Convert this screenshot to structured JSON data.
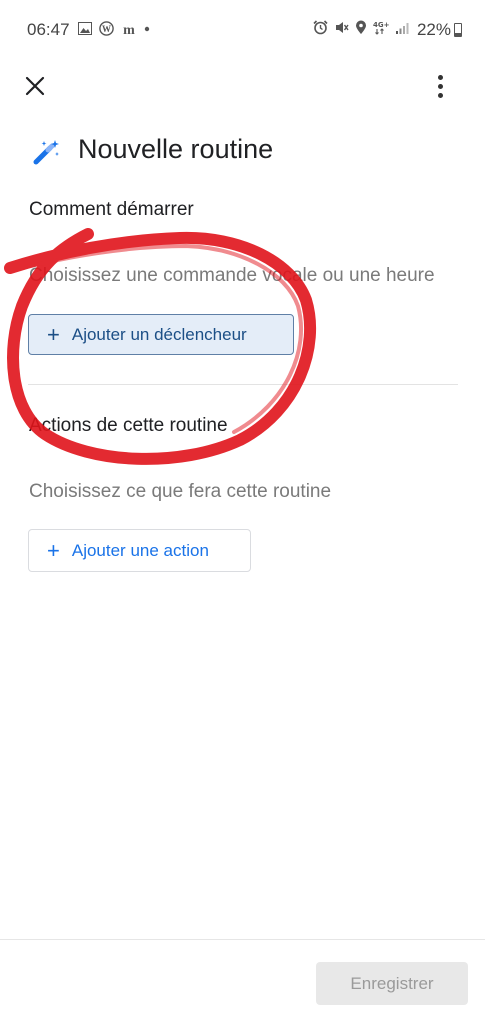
{
  "status_bar": {
    "time": "06:47",
    "left_icons": [
      "image-icon",
      "wordpress-icon",
      "m-icon",
      "dot-icon"
    ],
    "right_icons": [
      "alarm-icon",
      "mute-icon",
      "location-icon",
      "4g-icon",
      "signal-icon"
    ],
    "battery": "22%"
  },
  "toolbar": {
    "close_icon": "close-icon",
    "more_icon": "more-vert-icon"
  },
  "header": {
    "icon": "magic-wand-icon",
    "title": "Nouvelle routine"
  },
  "start_section": {
    "title": "Comment démarrer",
    "description": "Choisissez une commande vocale ou une heure",
    "button_label": "Ajouter un déclencheur"
  },
  "actions_section": {
    "title": "Actions de cette routine",
    "description": "Choisissez ce que fera cette routine",
    "button_label": "Ajouter une action"
  },
  "footer": {
    "save_label": "Enregistrer"
  },
  "colors": {
    "accent": "#1a73e8",
    "annotation": "#e0141b"
  }
}
